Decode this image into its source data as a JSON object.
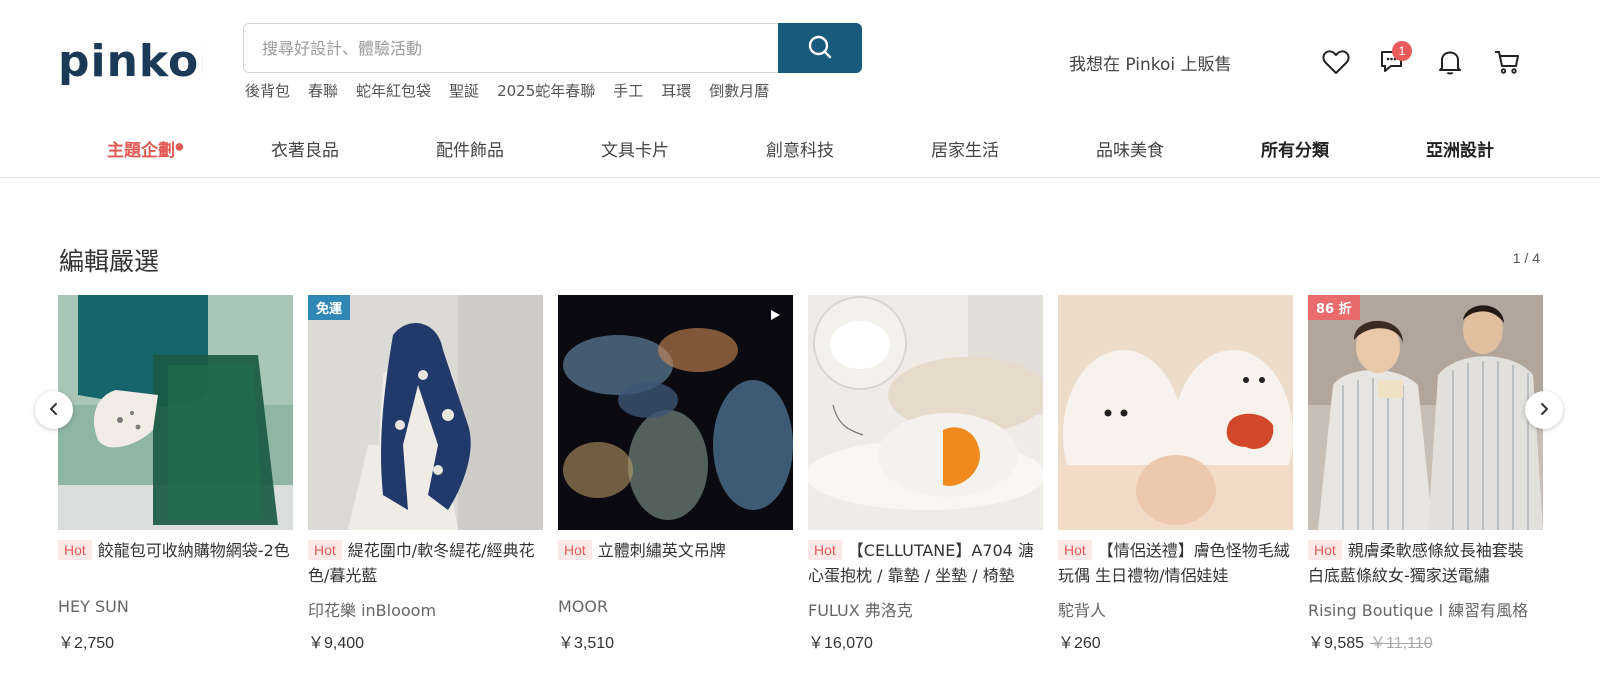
{
  "header": {
    "logo_text": "pinkoi",
    "search": {
      "placeholder": "搜尋好設計、體驗活動",
      "value": ""
    },
    "hot_keywords": [
      "後背包",
      "春聯",
      "蛇年紅包袋",
      "聖誕",
      "2025蛇年春聯",
      "手工",
      "耳環",
      "倒數月曆"
    ],
    "sell_link": "我想在 Pinkoi 上販售",
    "icons": [
      "heart-icon",
      "chat-icon",
      "bell-icon",
      "cart-icon"
    ],
    "chat_badge": "1"
  },
  "nav": {
    "items": [
      "主題企劃",
      "衣著良品",
      "配件飾品",
      "文具卡片",
      "創意科技",
      "居家生活",
      "品味美食",
      "所有分類",
      "亞洲設計"
    ]
  },
  "section": {
    "title": "編輯嚴選",
    "pager": "1 / 4",
    "products": [
      {
        "hot": "Hot",
        "tag": "",
        "title": "餃龍包可收納購物網袋-2色",
        "shop": "HEY SUN",
        "price": "￥2,750",
        "orig_price": ""
      },
      {
        "hot": "Hot",
        "tag": "免運",
        "title": "緹花圍巾/軟冬緹花/經典花色/暮光藍",
        "shop": "印花樂 inBlooom",
        "price": "￥9,400",
        "orig_price": ""
      },
      {
        "hot": "Hot",
        "tag": "",
        "title": "立體刺繡英文吊牌",
        "shop": "MOOR",
        "price": "￥3,510",
        "orig_price": ""
      },
      {
        "hot": "Hot",
        "tag": "",
        "title": "【CELLUTANE】A704 溏心蛋抱枕 / 靠墊 / 坐墊 / 椅墊",
        "shop": "FULUX 弗洛克",
        "price": "￥16,070",
        "orig_price": ""
      },
      {
        "hot": "Hot",
        "tag": "",
        "title": "【情侶送禮】膚色怪物毛絨玩偶 生日禮物/情侶娃娃",
        "shop": "駝背人",
        "price": "￥260",
        "orig_price": ""
      },
      {
        "hot": "Hot",
        "tag": "86 折",
        "title": "親膚柔軟感條紋長袖套裝 白底藍條紋女-獨家送電繡",
        "shop": "Rising Boutique l 練習有風格",
        "price": "￥9,585",
        "orig_price": "￥11,110"
      }
    ]
  },
  "colors": {
    "accent": "#175a7b",
    "featured": "#e25a54",
    "hot": "#e05a5a"
  }
}
